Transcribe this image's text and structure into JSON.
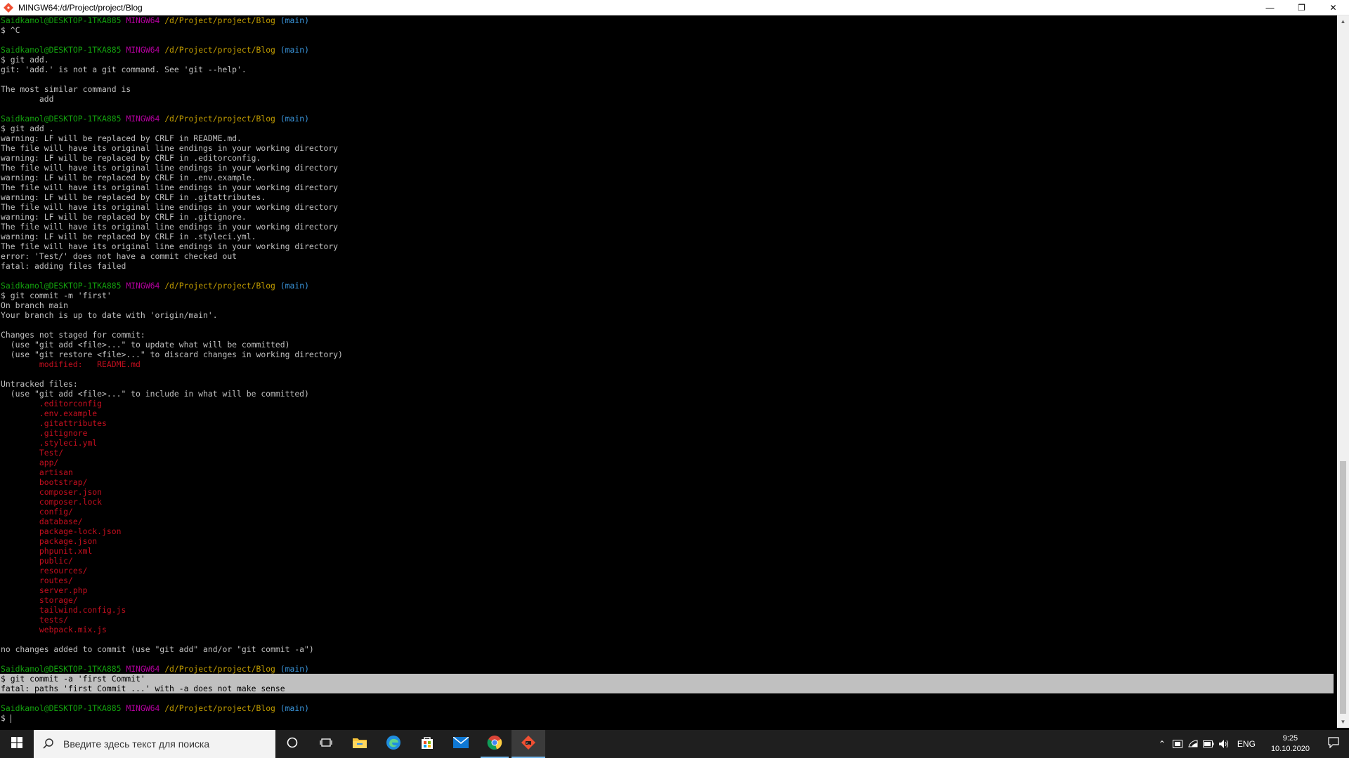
{
  "window": {
    "title": "MINGW64:/d/Project/project/Blog",
    "minimize": "—",
    "maximize": "❐",
    "close": "✕"
  },
  "terminal": {
    "lines": [
      [
        {
          "t": "Saidkamol@DESKTOP-1TKA885 ",
          "c": "green"
        },
        {
          "t": "MINGW64 ",
          "c": "magenta"
        },
        {
          "t": "/d/Project/project/Blog",
          "c": "yellow"
        },
        {
          "t": " (main)",
          "c": "cyan"
        }
      ],
      [
        {
          "t": "$ ^C",
          "c": ""
        }
      ],
      [
        {
          "t": "",
          "c": ""
        }
      ],
      [
        {
          "t": "Saidkamol@DESKTOP-1TKA885 ",
          "c": "green"
        },
        {
          "t": "MINGW64 ",
          "c": "magenta"
        },
        {
          "t": "/d/Project/project/Blog",
          "c": "yellow"
        },
        {
          "t": " (main)",
          "c": "cyan"
        }
      ],
      [
        {
          "t": "$ git add.",
          "c": ""
        }
      ],
      [
        {
          "t": "git: 'add.' is not a git command. See 'git --help'.",
          "c": ""
        }
      ],
      [
        {
          "t": "",
          "c": ""
        }
      ],
      [
        {
          "t": "The most similar command is",
          "c": ""
        }
      ],
      [
        {
          "t": "        add",
          "c": ""
        }
      ],
      [
        {
          "t": "",
          "c": ""
        }
      ],
      [
        {
          "t": "Saidkamol@DESKTOP-1TKA885 ",
          "c": "green"
        },
        {
          "t": "MINGW64 ",
          "c": "magenta"
        },
        {
          "t": "/d/Project/project/Blog",
          "c": "yellow"
        },
        {
          "t": " (main)",
          "c": "cyan"
        }
      ],
      [
        {
          "t": "$ git add .",
          "c": ""
        }
      ],
      [
        {
          "t": "warning: LF will be replaced by CRLF in README.md.",
          "c": ""
        }
      ],
      [
        {
          "t": "The file will have its original line endings in your working directory",
          "c": ""
        }
      ],
      [
        {
          "t": "warning: LF will be replaced by CRLF in .editorconfig.",
          "c": ""
        }
      ],
      [
        {
          "t": "The file will have its original line endings in your working directory",
          "c": ""
        }
      ],
      [
        {
          "t": "warning: LF will be replaced by CRLF in .env.example.",
          "c": ""
        }
      ],
      [
        {
          "t": "The file will have its original line endings in your working directory",
          "c": ""
        }
      ],
      [
        {
          "t": "warning: LF will be replaced by CRLF in .gitattributes.",
          "c": ""
        }
      ],
      [
        {
          "t": "The file will have its original line endings in your working directory",
          "c": ""
        }
      ],
      [
        {
          "t": "warning: LF will be replaced by CRLF in .gitignore.",
          "c": ""
        }
      ],
      [
        {
          "t": "The file will have its original line endings in your working directory",
          "c": ""
        }
      ],
      [
        {
          "t": "warning: LF will be replaced by CRLF in .styleci.yml.",
          "c": ""
        }
      ],
      [
        {
          "t": "The file will have its original line endings in your working directory",
          "c": ""
        }
      ],
      [
        {
          "t": "error: 'Test/' does not have a commit checked out",
          "c": ""
        }
      ],
      [
        {
          "t": "fatal: adding files failed",
          "c": ""
        }
      ],
      [
        {
          "t": "",
          "c": ""
        }
      ],
      [
        {
          "t": "Saidkamol@DESKTOP-1TKA885 ",
          "c": "green"
        },
        {
          "t": "MINGW64 ",
          "c": "magenta"
        },
        {
          "t": "/d/Project/project/Blog",
          "c": "yellow"
        },
        {
          "t": " (main)",
          "c": "cyan"
        }
      ],
      [
        {
          "t": "$ git commit -m 'first'",
          "c": ""
        }
      ],
      [
        {
          "t": "On branch main",
          "c": ""
        }
      ],
      [
        {
          "t": "Your branch is up to date with 'origin/main'.",
          "c": ""
        }
      ],
      [
        {
          "t": "",
          "c": ""
        }
      ],
      [
        {
          "t": "Changes not staged for commit:",
          "c": ""
        }
      ],
      [
        {
          "t": "  (use \"git add <file>...\" to update what will be committed)",
          "c": ""
        }
      ],
      [
        {
          "t": "  (use \"git restore <file>...\" to discard changes in working directory)",
          "c": ""
        }
      ],
      [
        {
          "t": "        modified:   README.md",
          "c": "red"
        }
      ],
      [
        {
          "t": "",
          "c": ""
        }
      ],
      [
        {
          "t": "Untracked files:",
          "c": ""
        }
      ],
      [
        {
          "t": "  (use \"git add <file>...\" to include in what will be committed)",
          "c": ""
        }
      ],
      [
        {
          "t": "        .editorconfig",
          "c": "red"
        }
      ],
      [
        {
          "t": "        .env.example",
          "c": "red"
        }
      ],
      [
        {
          "t": "        .gitattributes",
          "c": "red"
        }
      ],
      [
        {
          "t": "        .gitignore",
          "c": "red"
        }
      ],
      [
        {
          "t": "        .styleci.yml",
          "c": "red"
        }
      ],
      [
        {
          "t": "        Test/",
          "c": "red"
        }
      ],
      [
        {
          "t": "        app/",
          "c": "red"
        }
      ],
      [
        {
          "t": "        artisan",
          "c": "red"
        }
      ],
      [
        {
          "t": "        bootstrap/",
          "c": "red"
        }
      ],
      [
        {
          "t": "        composer.json",
          "c": "red"
        }
      ],
      [
        {
          "t": "        composer.lock",
          "c": "red"
        }
      ],
      [
        {
          "t": "        config/",
          "c": "red"
        }
      ],
      [
        {
          "t": "        database/",
          "c": "red"
        }
      ],
      [
        {
          "t": "        package-lock.json",
          "c": "red"
        }
      ],
      [
        {
          "t": "        package.json",
          "c": "red"
        }
      ],
      [
        {
          "t": "        phpunit.xml",
          "c": "red"
        }
      ],
      [
        {
          "t": "        public/",
          "c": "red"
        }
      ],
      [
        {
          "t": "        resources/",
          "c": "red"
        }
      ],
      [
        {
          "t": "        routes/",
          "c": "red"
        }
      ],
      [
        {
          "t": "        server.php",
          "c": "red"
        }
      ],
      [
        {
          "t": "        storage/",
          "c": "red"
        }
      ],
      [
        {
          "t": "        tailwind.config.js",
          "c": "red"
        }
      ],
      [
        {
          "t": "        tests/",
          "c": "red"
        }
      ],
      [
        {
          "t": "        webpack.mix.js",
          "c": "red"
        }
      ],
      [
        {
          "t": "",
          "c": ""
        }
      ],
      [
        {
          "t": "no changes added to commit (use \"git add\" and/or \"git commit -a\")",
          "c": ""
        }
      ],
      [
        {
          "t": "",
          "c": ""
        }
      ],
      [
        {
          "t": "Saidkamol@DESKTOP-1TKA885 ",
          "c": "green"
        },
        {
          "t": "MINGW64 ",
          "c": "magenta"
        },
        {
          "t": "/d/Project/project/Blog",
          "c": "yellow"
        },
        {
          "t": " (main)",
          "c": "cyan"
        }
      ],
      [
        {
          "t": "$ git commit -a 'first Commit'",
          "c": "sel"
        }
      ],
      [
        {
          "t": "fatal: paths 'first Commit ...' with -a does not make sense",
          "c": "sel"
        }
      ],
      [
        {
          "t": "",
          "c": ""
        }
      ],
      [
        {
          "t": "Saidkamol@DESKTOP-1TKA885 ",
          "c": "green"
        },
        {
          "t": "MINGW64 ",
          "c": "magenta"
        },
        {
          "t": "/d/Project/project/Blog",
          "c": "yellow"
        },
        {
          "t": " (main)",
          "c": "cyan"
        }
      ],
      [
        {
          "t": "$ ",
          "c": "prompt"
        }
      ]
    ]
  },
  "taskbar": {
    "search_placeholder": "Введите здесь текст для поиска",
    "language": "ENG",
    "time": "9:25",
    "date": "10.10.2020"
  },
  "colors": {
    "green": "#13a10e",
    "magenta": "#b4009e",
    "yellow": "#c19c00",
    "cyan": "#3a96dd",
    "red": "#c50f1f",
    "text": "#c0c0c0",
    "selection": "#c0c0c0"
  },
  "icons": {
    "app": "git-bash-icon",
    "start": "windows-logo-icon",
    "search": "search-icon",
    "cortana": "cortana-circle-icon",
    "taskview": "task-view-icon",
    "pinned": [
      "file-explorer-icon",
      "edge-icon",
      "store-icon",
      "mail-icon",
      "chrome-icon",
      "git-bash-icon"
    ]
  }
}
